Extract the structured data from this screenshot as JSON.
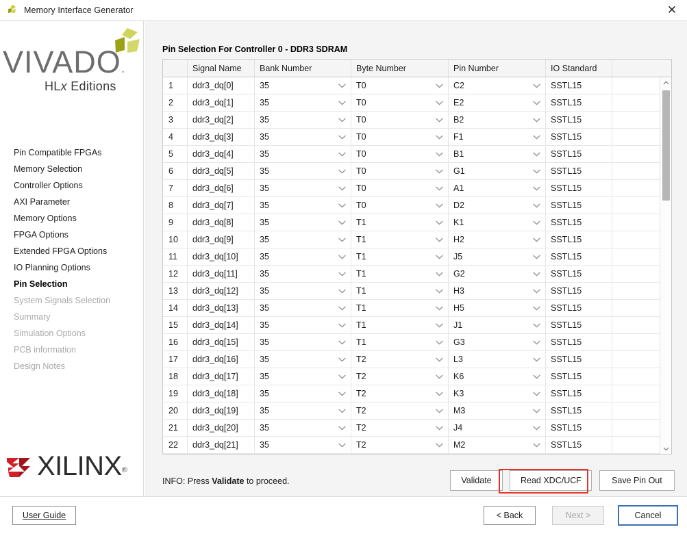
{
  "window": {
    "title": "Memory Interface Generator",
    "app_icon": "vivado-mark-icon",
    "close_icon": "close-icon"
  },
  "sidebar": {
    "logo": {
      "wordmark": "VIVADO",
      "dot": ".",
      "subtitle_pre": "HL",
      "subtitle_italic": "x",
      "subtitle_post": " Editions"
    },
    "items": [
      {
        "label": "Pin Compatible FPGAs",
        "state": "enabled"
      },
      {
        "label": "Memory Selection",
        "state": "enabled"
      },
      {
        "label": "Controller Options",
        "state": "enabled"
      },
      {
        "label": "AXI Parameter",
        "state": "enabled"
      },
      {
        "label": "Memory Options",
        "state": "enabled"
      },
      {
        "label": "FPGA Options",
        "state": "enabled"
      },
      {
        "label": "Extended FPGA Options",
        "state": "enabled"
      },
      {
        "label": "IO Planning Options",
        "state": "enabled"
      },
      {
        "label": "Pin Selection",
        "state": "active"
      },
      {
        "label": "System Signals Selection",
        "state": "disabled"
      },
      {
        "label": "Summary",
        "state": "disabled"
      },
      {
        "label": "Simulation Options",
        "state": "disabled"
      },
      {
        "label": "PCB information",
        "state": "disabled"
      },
      {
        "label": "Design Notes",
        "state": "disabled"
      }
    ],
    "vendor_logo": {
      "wordmark": "XILINX",
      "registered": "®"
    }
  },
  "main": {
    "panel_title": "Pin Selection For Controller 0 - DDR3 SDRAM",
    "table": {
      "columns": [
        "",
        "Signal Name",
        "Bank Number",
        "Byte Number",
        "Pin Number",
        "IO Standard",
        ""
      ],
      "rows": [
        {
          "n": "1",
          "signal": "ddr3_dq[0]",
          "bank": "35",
          "byte": "T0",
          "pin": "C2",
          "io": "SSTL15"
        },
        {
          "n": "2",
          "signal": "ddr3_dq[1]",
          "bank": "35",
          "byte": "T0",
          "pin": "E2",
          "io": "SSTL15"
        },
        {
          "n": "3",
          "signal": "ddr3_dq[2]",
          "bank": "35",
          "byte": "T0",
          "pin": "B2",
          "io": "SSTL15"
        },
        {
          "n": "4",
          "signal": "ddr3_dq[3]",
          "bank": "35",
          "byte": "T0",
          "pin": "F1",
          "io": "SSTL15"
        },
        {
          "n": "5",
          "signal": "ddr3_dq[4]",
          "bank": "35",
          "byte": "T0",
          "pin": "B1",
          "io": "SSTL15"
        },
        {
          "n": "6",
          "signal": "ddr3_dq[5]",
          "bank": "35",
          "byte": "T0",
          "pin": "G1",
          "io": "SSTL15"
        },
        {
          "n": "7",
          "signal": "ddr3_dq[6]",
          "bank": "35",
          "byte": "T0",
          "pin": "A1",
          "io": "SSTL15"
        },
        {
          "n": "8",
          "signal": "ddr3_dq[7]",
          "bank": "35",
          "byte": "T0",
          "pin": "D2",
          "io": "SSTL15"
        },
        {
          "n": "9",
          "signal": "ddr3_dq[8]",
          "bank": "35",
          "byte": "T1",
          "pin": "K1",
          "io": "SSTL15"
        },
        {
          "n": "10",
          "signal": "ddr3_dq[9]",
          "bank": "35",
          "byte": "T1",
          "pin": "H2",
          "io": "SSTL15"
        },
        {
          "n": "11",
          "signal": "ddr3_dq[10]",
          "bank": "35",
          "byte": "T1",
          "pin": "J5",
          "io": "SSTL15"
        },
        {
          "n": "12",
          "signal": "ddr3_dq[11]",
          "bank": "35",
          "byte": "T1",
          "pin": "G2",
          "io": "SSTL15"
        },
        {
          "n": "13",
          "signal": "ddr3_dq[12]",
          "bank": "35",
          "byte": "T1",
          "pin": "H3",
          "io": "SSTL15"
        },
        {
          "n": "14",
          "signal": "ddr3_dq[13]",
          "bank": "35",
          "byte": "T1",
          "pin": "H5",
          "io": "SSTL15"
        },
        {
          "n": "15",
          "signal": "ddr3_dq[14]",
          "bank": "35",
          "byte": "T1",
          "pin": "J1",
          "io": "SSTL15"
        },
        {
          "n": "16",
          "signal": "ddr3_dq[15]",
          "bank": "35",
          "byte": "T1",
          "pin": "G3",
          "io": "SSTL15"
        },
        {
          "n": "17",
          "signal": "ddr3_dq[16]",
          "bank": "35",
          "byte": "T2",
          "pin": "L3",
          "io": "SSTL15"
        },
        {
          "n": "18",
          "signal": "ddr3_dq[17]",
          "bank": "35",
          "byte": "T2",
          "pin": "K6",
          "io": "SSTL15"
        },
        {
          "n": "19",
          "signal": "ddr3_dq[18]",
          "bank": "35",
          "byte": "T2",
          "pin": "K3",
          "io": "SSTL15"
        },
        {
          "n": "20",
          "signal": "ddr3_dq[19]",
          "bank": "35",
          "byte": "T2",
          "pin": "M3",
          "io": "SSTL15"
        },
        {
          "n": "21",
          "signal": "ddr3_dq[20]",
          "bank": "35",
          "byte": "T2",
          "pin": "J4",
          "io": "SSTL15"
        },
        {
          "n": "22",
          "signal": "ddr3_dq[21]",
          "bank": "35",
          "byte": "T2",
          "pin": "M2",
          "io": "SSTL15"
        }
      ]
    },
    "info": {
      "prefix": "INFO: Press ",
      "emphasis": "Validate",
      "suffix": " to proceed."
    },
    "actions": {
      "validate": "Validate",
      "read_xdc_ucf": "Read XDC/UCF",
      "save_pin_out": "Save Pin Out",
      "highlight_color": "#e8352b",
      "highlighted": "read_xdc_ucf"
    }
  },
  "footer": {
    "user_guide": "User Guide",
    "back": "< Back",
    "next": "Next >",
    "cancel": "Cancel",
    "next_state": "disabled",
    "cancel_focus_color": "#3f6fb5"
  }
}
